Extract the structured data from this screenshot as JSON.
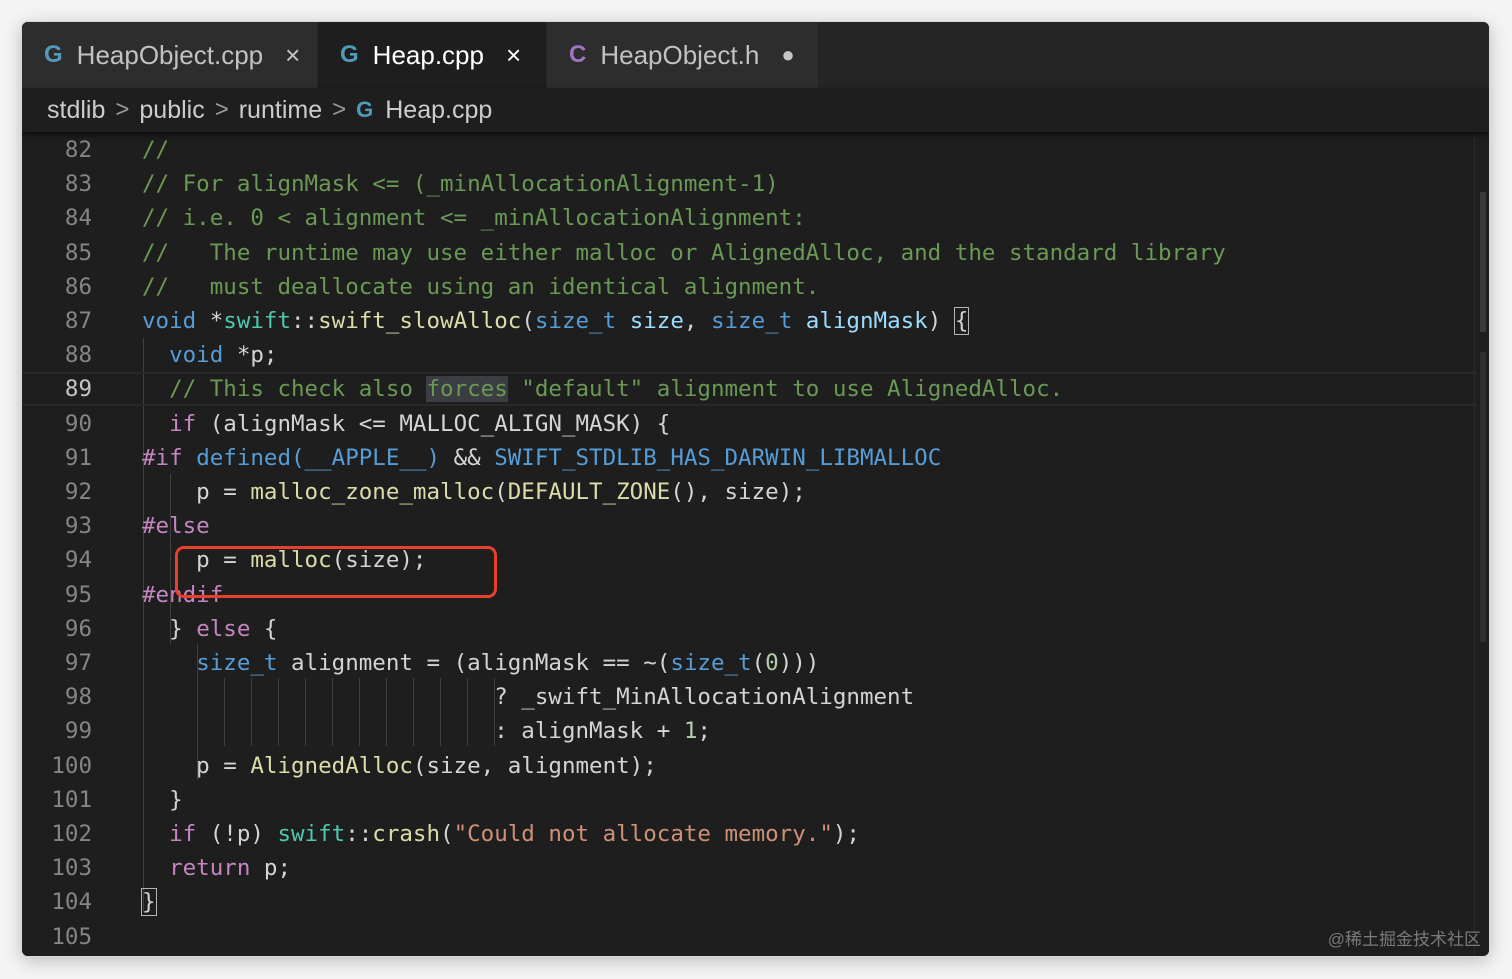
{
  "tabs": [
    {
      "icon": "cpp-file-icon",
      "label": "HeapObject.cpp",
      "state": "×"
    },
    {
      "icon": "cpp-file-icon",
      "label": "Heap.cpp",
      "state": "×"
    },
    {
      "icon": "c-header-file-icon",
      "label": "HeapObject.h",
      "state": "●"
    }
  ],
  "breadcrumb": {
    "items": [
      "stdlib",
      "public",
      "runtime"
    ],
    "file": "Heap.cpp",
    "separator": ">"
  },
  "editor": {
    "current_line": 89,
    "line_numbers": [
      "82",
      "83",
      "84",
      "85",
      "86",
      "87",
      "88",
      "89",
      "90",
      "91",
      "92",
      "93",
      "94",
      "95",
      "96",
      "97",
      "98",
      "99",
      "100",
      "101",
      "102",
      "103",
      "104",
      "105"
    ],
    "lines": [
      [
        [
          "cm",
          "//"
        ]
      ],
      [
        [
          "cm",
          "// For alignMask <= (_minAllocationAlignment-1)"
        ]
      ],
      [
        [
          "cm",
          "// i.e. 0 < alignment <= _minAllocationAlignment:"
        ]
      ],
      [
        [
          "cm",
          "//   The runtime may use either malloc or AlignedAlloc, and the standard library"
        ]
      ],
      [
        [
          "cm",
          "//   must deallocate using an identical alignment."
        ]
      ],
      [
        [
          "kw",
          "void"
        ],
        [
          "tx",
          " *"
        ],
        [
          "ty",
          "swift"
        ],
        [
          "tx",
          "::"
        ],
        [
          "fn",
          "swift_slowAlloc"
        ],
        [
          "tx",
          "("
        ],
        [
          "kw",
          "size_t"
        ],
        [
          "tx",
          " "
        ],
        [
          "pv",
          "size"
        ],
        [
          "tx",
          ", "
        ],
        [
          "kw",
          "size_t"
        ],
        [
          "tx",
          " "
        ],
        [
          "pv",
          "alignMask"
        ],
        [
          "tx",
          ") "
        ],
        [
          "brk",
          "{"
        ]
      ],
      [
        [
          "tx",
          "  "
        ],
        [
          "kw",
          "void"
        ],
        [
          "tx",
          " *p;"
        ]
      ],
      [
        [
          "tx",
          "  "
        ],
        [
          "cm",
          "// This check also "
        ],
        [
          "cmhl",
          "forces"
        ],
        [
          "cm",
          " \"default\" alignment to use AlignedAlloc."
        ]
      ],
      [
        [
          "tx",
          "  "
        ],
        [
          "ctl",
          "if"
        ],
        [
          "tx",
          " (alignMask <= MALLOC_ALIGN_MASK) {"
        ]
      ],
      [
        [
          "ctl",
          "#if"
        ],
        [
          "tx",
          " "
        ],
        [
          "kw",
          "defined"
        ],
        [
          "mac",
          "(__APPLE__)"
        ],
        [
          "tx",
          " && "
        ],
        [
          "mac",
          "SWIFT_STDLIB_HAS_DARWIN_LIBMALLOC"
        ]
      ],
      [
        [
          "tx",
          "    p = "
        ],
        [
          "fn",
          "malloc_zone_malloc"
        ],
        [
          "tx",
          "("
        ],
        [
          "fn",
          "DEFAULT_ZONE"
        ],
        [
          "tx",
          "(), size);"
        ]
      ],
      [
        [
          "ctl",
          "#else"
        ]
      ],
      [
        [
          "tx",
          "    p = "
        ],
        [
          "fn",
          "malloc"
        ],
        [
          "tx",
          "(size);"
        ]
      ],
      [
        [
          "ctl",
          "#endif"
        ]
      ],
      [
        [
          "tx",
          "  } "
        ],
        [
          "ctl",
          "else"
        ],
        [
          "tx",
          " {"
        ]
      ],
      [
        [
          "tx",
          "    "
        ],
        [
          "kw",
          "size_t"
        ],
        [
          "tx",
          " alignment = (alignMask == ~("
        ],
        [
          "kw",
          "size_t"
        ],
        [
          "tx",
          "("
        ],
        [
          "num",
          "0"
        ],
        [
          "tx",
          ")))"
        ]
      ],
      [
        [
          "tx",
          "                          ? _swift_MinAllocationAlignment"
        ]
      ],
      [
        [
          "tx",
          "                          : alignMask + "
        ],
        [
          "num",
          "1"
        ],
        [
          "tx",
          ";"
        ]
      ],
      [
        [
          "tx",
          "    p = "
        ],
        [
          "fn",
          "AlignedAlloc"
        ],
        [
          "tx",
          "(size, alignment);"
        ]
      ],
      [
        [
          "tx",
          "  }"
        ]
      ],
      [
        [
          "tx",
          "  "
        ],
        [
          "ctl",
          "if"
        ],
        [
          "tx",
          " (!p) "
        ],
        [
          "ty",
          "swift"
        ],
        [
          "tx",
          "::"
        ],
        [
          "fn",
          "crash"
        ],
        [
          "tx",
          "("
        ],
        [
          "str",
          "\"Could not allocate memory.\""
        ],
        [
          "tx",
          ");"
        ]
      ],
      [
        [
          "tx",
          "  "
        ],
        [
          "ctl",
          "return"
        ],
        [
          "tx",
          " p;"
        ]
      ],
      [
        [
          "brk",
          "}"
        ]
      ],
      []
    ]
  },
  "watermark": "@稀土掘金技术社区"
}
